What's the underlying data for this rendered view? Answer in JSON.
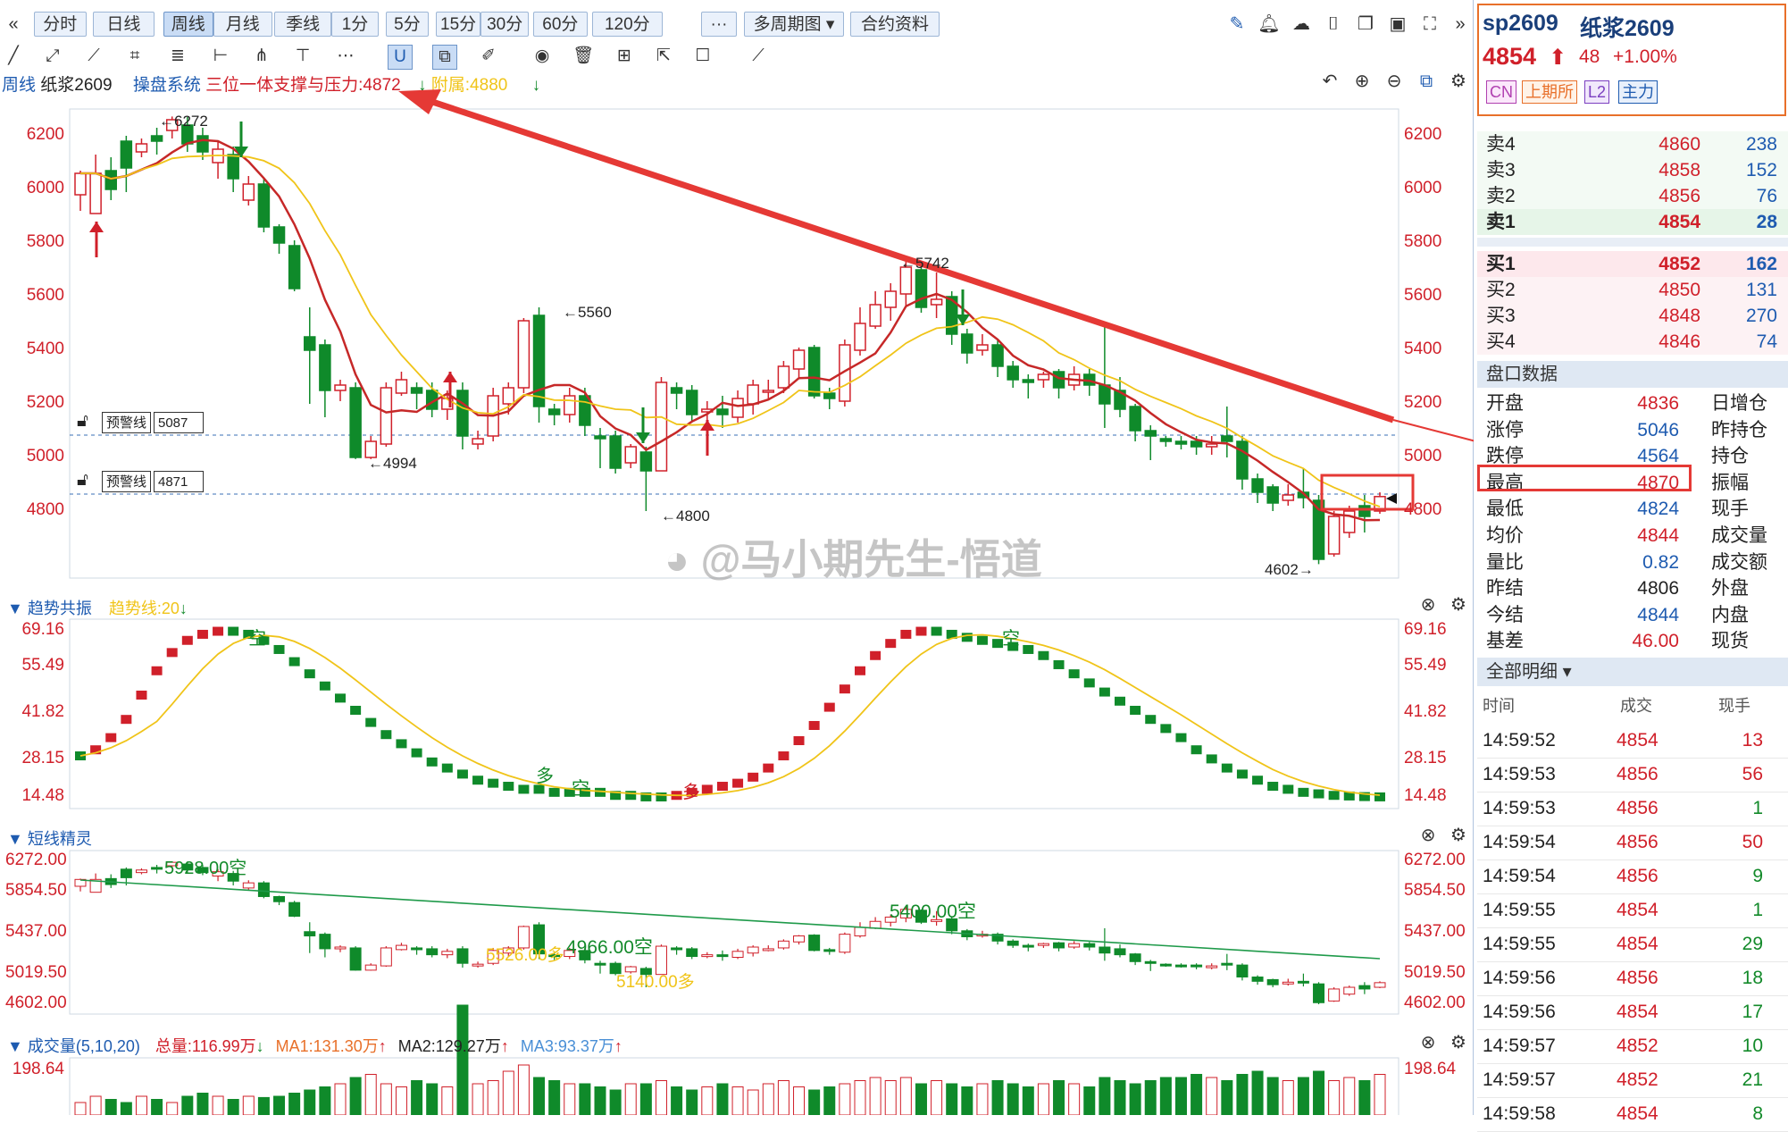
{
  "toolbar": {
    "periods": [
      "分时",
      "日线",
      "周线",
      "月线",
      "季线",
      "1分",
      "5分",
      "15分",
      "30分",
      "60分",
      "120分"
    ],
    "active_period": "周线",
    "more_label": "···",
    "multi_period": "多周期图",
    "contract_info": "合约资料"
  },
  "chart_header": {
    "period": "周线",
    "name": "纸浆2609",
    "system": "操盘系统",
    "indicator": "三位一体支撑与压力:4872",
    "attached": "附属:4880"
  },
  "main_chart": {
    "price_ticks": [
      "6200",
      "6000",
      "5800",
      "5600",
      "5400",
      "5200",
      "5000",
      "4800"
    ],
    "annotations": {
      "high1": "←6272",
      "high2": "←5560",
      "low1": "←4994",
      "low2": "←4800",
      "low3": "4602→",
      "peak": "←5742"
    },
    "warnings": [
      {
        "label": "预警线",
        "value": "5087"
      },
      {
        "label": "预警线",
        "value": "4871"
      }
    ],
    "watermark": "@马小期先生-悟道"
  },
  "panels": {
    "trend": {
      "title": "趋势共振",
      "line": "趋势线:20",
      "ticks": [
        "69.16",
        "55.49",
        "41.82",
        "28.15",
        "14.48"
      ],
      "labels": [
        "空",
        "多",
        "空",
        "多",
        "空"
      ]
    },
    "short": {
      "title": "短线精灵",
      "ticks": [
        "6272.00",
        "5854.50",
        "5437.00",
        "5019.50",
        "4602.00"
      ],
      "labels": [
        "5928.00空",
        "5526.00多",
        "4966.00空",
        "5140.00多",
        "5400.00空"
      ]
    },
    "volume": {
      "title": "成交量(5,10,20)",
      "total": "总量:116.99万",
      "ma1": "MA1:131.30万",
      "ma2": "MA2:129.27万",
      "ma3": "MA3:93.37万",
      "tick": "198.64"
    }
  },
  "quote": {
    "code": "sp2609",
    "name": "纸浆2609",
    "price": "4854",
    "change": "48",
    "pct": "+1.00%",
    "tags": [
      "CN",
      "上期所",
      "L2",
      "主力"
    ],
    "asks": [
      {
        "label": "卖4",
        "price": "4860",
        "vol": "238"
      },
      {
        "label": "卖3",
        "price": "4858",
        "vol": "152"
      },
      {
        "label": "卖2",
        "price": "4856",
        "vol": "76"
      },
      {
        "label": "卖1",
        "price": "4854",
        "vol": "28"
      }
    ],
    "bids": [
      {
        "label": "买1",
        "price": "4852",
        "vol": "162"
      },
      {
        "label": "买2",
        "price": "4850",
        "vol": "131"
      },
      {
        "label": "买3",
        "price": "4848",
        "vol": "270"
      },
      {
        "label": "买4",
        "price": "4846",
        "vol": "74"
      }
    ],
    "panel_title": "盘口数据",
    "stats": [
      {
        "label": "开盘",
        "value": "4836",
        "right": "日增仓"
      },
      {
        "label": "涨停",
        "value": "5046",
        "right": "昨持仓"
      },
      {
        "label": "跌停",
        "value": "4564",
        "right": "持仓"
      },
      {
        "label": "最高",
        "value": "4870",
        "right": "振幅"
      },
      {
        "label": "最低",
        "value": "4824",
        "right": "现手"
      },
      {
        "label": "均价",
        "value": "4844",
        "right": "成交量"
      },
      {
        "label": "量比",
        "value": "0.82",
        "right": "成交额"
      },
      {
        "label": "昨结",
        "value": "4806",
        "right": "外盘"
      },
      {
        "label": "今结",
        "value": "4844",
        "right": "内盘"
      },
      {
        "label": "基差",
        "value": "46.00",
        "right": "现货"
      }
    ],
    "detail_title": "全部明细",
    "trade_headers": [
      "时间",
      "成交",
      "现手"
    ],
    "trades": [
      {
        "time": "14:59:52",
        "price": "4854",
        "vol": "13"
      },
      {
        "time": "14:59:53",
        "price": "4856",
        "vol": "56"
      },
      {
        "time": "14:59:53",
        "price": "4856",
        "vol": "1"
      },
      {
        "time": "14:59:54",
        "price": "4856",
        "vol": "50"
      },
      {
        "time": "14:59:54",
        "price": "4856",
        "vol": "9"
      },
      {
        "time": "14:59:55",
        "price": "4854",
        "vol": "1"
      },
      {
        "time": "14:59:55",
        "price": "4854",
        "vol": "29"
      },
      {
        "time": "14:59:56",
        "price": "4856",
        "vol": "18"
      },
      {
        "time": "14:59:56",
        "price": "4854",
        "vol": "17"
      },
      {
        "time": "14:59:57",
        "price": "4852",
        "vol": "10"
      },
      {
        "time": "14:59:57",
        "price": "4852",
        "vol": "21"
      },
      {
        "time": "14:59:58",
        "price": "4854",
        "vol": "8"
      }
    ]
  },
  "chart_data": {
    "type": "candlestick",
    "period": "weekly",
    "ylim": [
      4600,
      6300
    ],
    "candles": [
      [
        5980,
        6060,
        5920,
        6070
      ],
      [
        5910,
        6060,
        5920,
        6130
      ],
      [
        6070,
        6000,
        5960,
        6120
      ],
      [
        6180,
        6080,
        5990,
        6200
      ],
      [
        6140,
        6170,
        6120,
        6190
      ],
      [
        6200,
        6180,
        6130,
        6230
      ],
      [
        6220,
        6260,
        6190,
        6272
      ],
      [
        6240,
        6170,
        6140,
        6270
      ],
      [
        6200,
        6140,
        6110,
        6230
      ],
      [
        6100,
        6150,
        6040,
        6180
      ],
      [
        6130,
        6040,
        5990,
        6160
      ],
      [
        5960,
        6020,
        5940,
        6050
      ],
      [
        6020,
        5860,
        5840,
        6040
      ],
      [
        5860,
        5800,
        5760,
        5870
      ],
      [
        5790,
        5630,
        5620,
        5810
      ],
      [
        5450,
        5400,
        5200,
        5560
      ],
      [
        5420,
        5250,
        5150,
        5440
      ],
      [
        5250,
        5270,
        5210,
        5290
      ],
      [
        5260,
        5000,
        4994,
        5280
      ],
      [
        5000,
        5060,
        4994,
        5080
      ],
      [
        5050,
        5260,
        5040,
        5280
      ],
      [
        5240,
        5290,
        5230,
        5320
      ],
      [
        5260,
        5240,
        5180,
        5280
      ],
      [
        5250,
        5180,
        5150,
        5280
      ],
      [
        5180,
        5220,
        5140,
        5250
      ],
      [
        5250,
        5080,
        5030,
        5280
      ],
      [
        5050,
        5070,
        5030,
        5100
      ],
      [
        5080,
        5230,
        5060,
        5260
      ],
      [
        5200,
        5260,
        5160,
        5280
      ],
      [
        5260,
        5510,
        5240,
        5520
      ],
      [
        5530,
        5190,
        5130,
        5560
      ],
      [
        5180,
        5160,
        5120,
        5200
      ],
      [
        5160,
        5230,
        5130,
        5260
      ],
      [
        5230,
        5120,
        5080,
        5260
      ],
      [
        5080,
        5070,
        4960,
        5110
      ],
      [
        5080,
        4960,
        4940,
        5100
      ],
      [
        4980,
        5040,
        4960,
        5050
      ],
      [
        5020,
        4950,
        4800,
        5040
      ],
      [
        4950,
        5280,
        4950,
        5300
      ],
      [
        5260,
        5240,
        5180,
        5280
      ],
      [
        5250,
        5160,
        5130,
        5270
      ],
      [
        5170,
        5180,
        5140,
        5210
      ],
      [
        5180,
        5160,
        5110,
        5230
      ],
      [
        5150,
        5220,
        5130,
        5250
      ],
      [
        5200,
        5270,
        5160,
        5290
      ],
      [
        5250,
        5250,
        5220,
        5290
      ],
      [
        5260,
        5340,
        5240,
        5360
      ],
      [
        5330,
        5400,
        5300,
        5410
      ],
      [
        5410,
        5230,
        5220,
        5420
      ],
      [
        5240,
        5220,
        5180,
        5260
      ],
      [
        5210,
        5420,
        5190,
        5440
      ],
      [
        5400,
        5500,
        5380,
        5560
      ],
      [
        5490,
        5570,
        5480,
        5620
      ],
      [
        5560,
        5620,
        5510,
        5650
      ],
      [
        5610,
        5710,
        5560,
        5742
      ],
      [
        5700,
        5560,
        5540,
        5710
      ],
      [
        5570,
        5590,
        5520,
        5690
      ],
      [
        5600,
        5460,
        5420,
        5620
      ],
      [
        5460,
        5390,
        5350,
        5480
      ],
      [
        5400,
        5420,
        5380,
        5460
      ],
      [
        5420,
        5340,
        5300,
        5440
      ],
      [
        5340,
        5290,
        5260,
        5360
      ],
      [
        5290,
        5280,
        5220,
        5310
      ],
      [
        5290,
        5310,
        5260,
        5320
      ],
      [
        5320,
        5260,
        5220,
        5330
      ],
      [
        5270,
        5310,
        5250,
        5340
      ],
      [
        5310,
        5270,
        5230,
        5330
      ],
      [
        5270,
        5200,
        5110,
        5490
      ],
      [
        5250,
        5180,
        5150,
        5300
      ],
      [
        5190,
        5100,
        5060,
        5200
      ],
      [
        5100,
        5080,
        4990,
        5120
      ],
      [
        5070,
        5060,
        5040,
        5080
      ],
      [
        5060,
        5050,
        5030,
        5080
      ],
      [
        5060,
        5040,
        5010,
        5080
      ],
      [
        5040,
        5050,
        5010,
        5080
      ],
      [
        5080,
        5060,
        5000,
        5190
      ],
      [
        5060,
        4920,
        4880,
        5080
      ],
      [
        4920,
        4870,
        4830,
        4940
      ],
      [
        4890,
        4830,
        4800,
        4900
      ],
      [
        4840,
        4860,
        4820,
        4900
      ],
      [
        4870,
        4850,
        4810,
        4960
      ],
      [
        4840,
        4620,
        4602,
        4860
      ],
      [
        4640,
        4780,
        4630,
        4800
      ],
      [
        4720,
        4800,
        4700,
        4820
      ],
      [
        4820,
        4780,
        4720,
        4860
      ],
      [
        4800,
        4854,
        4790,
        4870
      ]
    ],
    "ma_red_desc": "short moving average",
    "ma_yellow_desc": "long moving average"
  }
}
